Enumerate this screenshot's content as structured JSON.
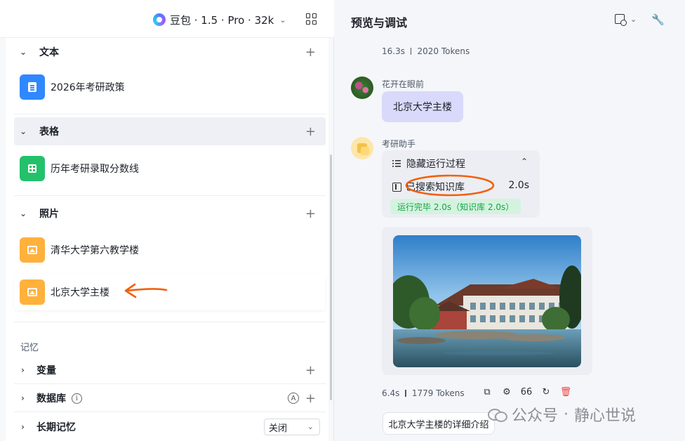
{
  "header": {
    "model_name": "豆包 · 1.5 · Pro · 32k"
  },
  "knowledge": {
    "sections": [
      {
        "title": "文本",
        "items": [
          "2026年考研政策"
        ]
      },
      {
        "title": "表格",
        "items": [
          "历年考研录取分数线"
        ]
      },
      {
        "title": "照片",
        "items": [
          "清华大学第六教学楼",
          "北京大学主楼"
        ]
      }
    ]
  },
  "memory": {
    "label": "记忆",
    "variables": "变量",
    "database": "数据库",
    "database_info": "i",
    "database_auto": "A",
    "long_term": "长期记忆",
    "long_term_value": "关闭"
  },
  "preview": {
    "title": "预览与调试",
    "prev_meta": {
      "time": "16.3s",
      "tokens": "2020 Tokens"
    },
    "user": {
      "name": "花开在眼前",
      "message": "北京大学主楼"
    },
    "bot": {
      "name": "考研助手",
      "process_label": "隐藏运行过程",
      "step_label": "已搜索知识库",
      "step_time": "2.0s",
      "status": "运行完毕 2.0s（知识库 2.0s）"
    },
    "reply_meta": {
      "time": "6.4s",
      "tokens": "1779 Tokens"
    },
    "quote_glyph": "66",
    "suggestion": "北京大学主楼的详细介绍"
  },
  "watermark": {
    "brand": "公众号",
    "dot": "·",
    "author": "静心世说"
  },
  "colors": {
    "accent_orange": "#f2600c",
    "status_green": "#17a34a",
    "user_bubble": "#d9d9fb"
  }
}
